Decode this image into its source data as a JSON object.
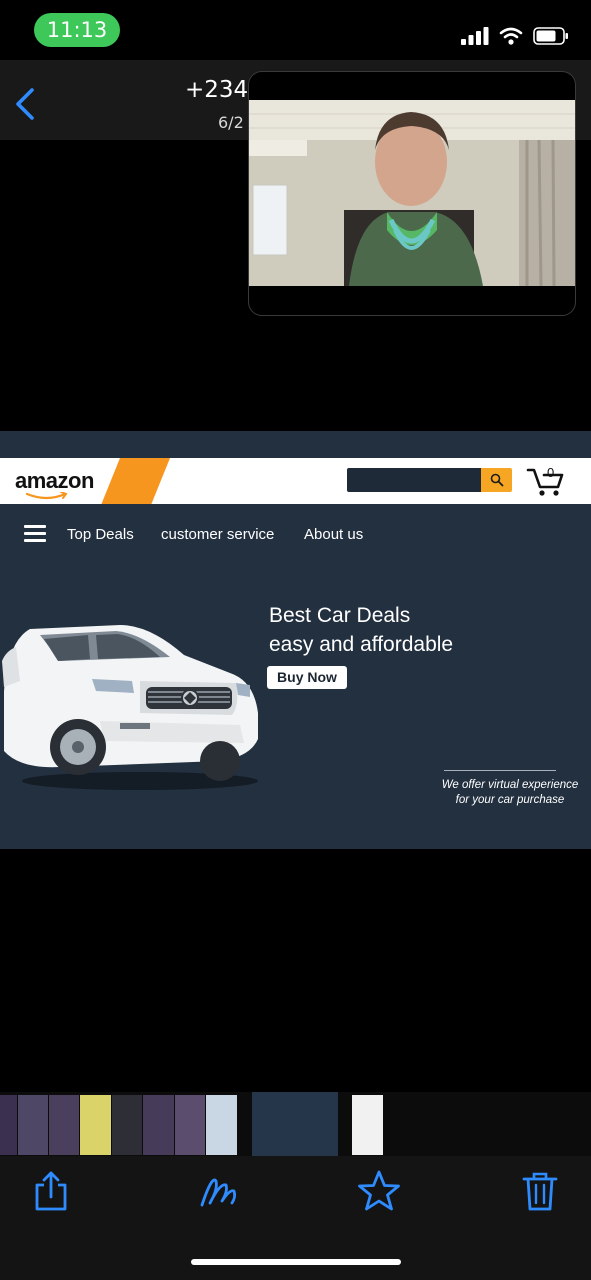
{
  "status_bar": {
    "time": "11:13"
  },
  "header": {
    "caller_number": "+234",
    "caller_date": "6/2"
  },
  "webpage": {
    "logo": "amazon",
    "cart_count": "0",
    "nav": [
      "Top Deals",
      "customer service",
      "About us"
    ],
    "hero_title_line1": "Best Car Deals",
    "hero_title_line2": "easy and affordable",
    "buy_button": "Buy Now",
    "tagline_line1": "We offer virtual experience",
    "tagline_line2": "for your car purchase"
  },
  "colors": {
    "status_pill": "#3ec85a",
    "accent_blue": "#2f8cff",
    "web_bg": "#233040",
    "amazon_orange": "#f6961e"
  },
  "toolbar": {
    "icons": [
      "share-icon",
      "markup-icon",
      "favorite-icon",
      "delete-icon"
    ]
  }
}
